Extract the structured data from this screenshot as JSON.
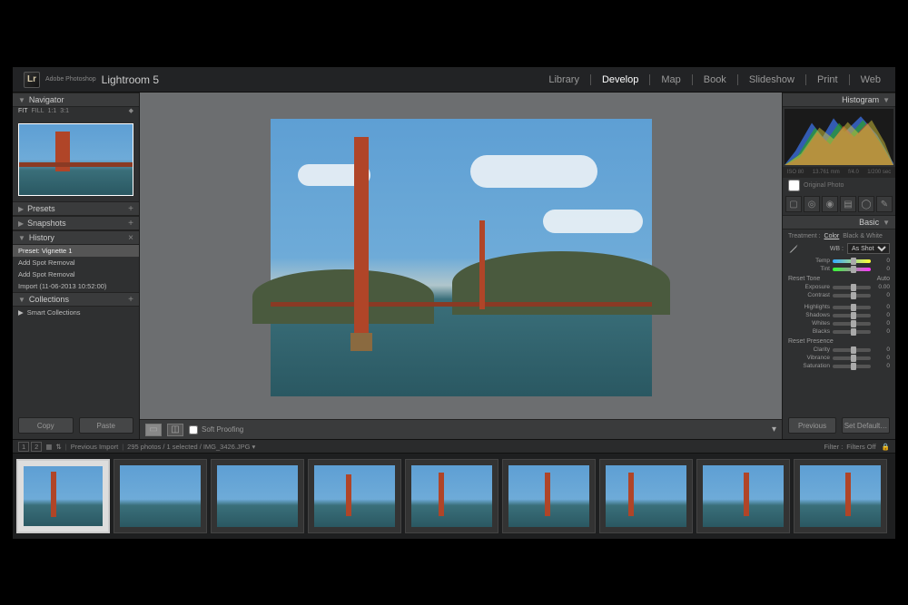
{
  "app": {
    "logo": "Lr",
    "brand_top": "Adobe Photoshop",
    "brand_main": "Lightroom 5"
  },
  "modules": [
    "Library",
    "Develop",
    "Map",
    "Book",
    "Slideshow",
    "Print",
    "Web"
  ],
  "active_module": "Develop",
  "left": {
    "navigator": {
      "title": "Navigator",
      "levels": [
        "FIT",
        "FILL",
        "1:1",
        "3:1"
      ]
    },
    "presets": "Presets",
    "snapshots": "Snapshots",
    "history": {
      "title": "History",
      "items": [
        "Preset: Vignette 1",
        "Add Spot Removal",
        "Add Spot Removal",
        "Import (11-06-2013 10:52:00)"
      ],
      "selected": 0
    },
    "collections": {
      "title": "Collections",
      "items": [
        "Smart Collections"
      ]
    },
    "copy": "Copy",
    "paste": "Paste"
  },
  "center": {
    "soft_proofing": "Soft Proofing"
  },
  "right": {
    "histogram": {
      "title": "Histogram",
      "info": [
        "ISO 80",
        "13.761 mm",
        "f/4.0",
        "1/200 sec"
      ]
    },
    "original": "Original Photo",
    "basic": {
      "title": "Basic",
      "treatment_label": "Treatment :",
      "treatment": [
        "Color",
        "Black & White"
      ],
      "treatment_active": "Color",
      "wb_label": "WB :",
      "wb_value": "As Shot",
      "temp": {
        "label": "Temp",
        "value": 0
      },
      "tint": {
        "label": "Tint",
        "value": 0
      },
      "reset_tone": "Reset Tone",
      "auto": "Auto",
      "exposure": {
        "label": "Exposure",
        "value": "0.00"
      },
      "contrast": {
        "label": "Contrast",
        "value": 0
      },
      "highlights": {
        "label": "Highlights",
        "value": 0
      },
      "shadows": {
        "label": "Shadows",
        "value": 0
      },
      "whites": {
        "label": "Whites",
        "value": 0
      },
      "blacks": {
        "label": "Blacks",
        "value": 0
      },
      "reset_presence": "Reset Presence",
      "clarity": {
        "label": "Clarity",
        "value": 0
      },
      "vibrance": {
        "label": "Vibrance",
        "value": 0
      },
      "saturation": {
        "label": "Saturation",
        "value": 0
      }
    },
    "previous": "Previous",
    "set_default": "Set Default…"
  },
  "status": {
    "source": "Previous Import",
    "count": "295 photos / 1 selected",
    "file": "IMG_3426.JPG",
    "filter_label": "Filter :",
    "filter_value": "Filters Off"
  },
  "thumbs": 9
}
